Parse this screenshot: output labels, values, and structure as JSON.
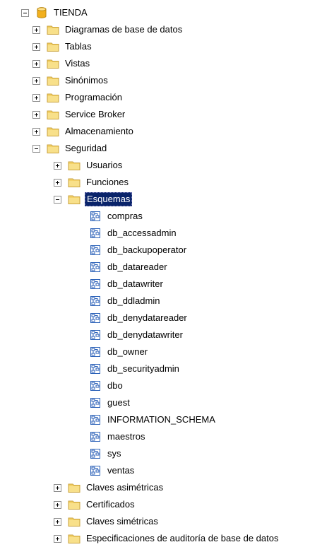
{
  "tree": {
    "root": {
      "label": "TIENDA",
      "icon": "database-icon",
      "expanded": true
    },
    "items": [
      {
        "label": "Diagramas de base de datos",
        "icon": "folder-icon",
        "expander": "plus"
      },
      {
        "label": "Tablas",
        "icon": "folder-icon",
        "expander": "plus"
      },
      {
        "label": "Vistas",
        "icon": "folder-icon",
        "expander": "plus"
      },
      {
        "label": "Sinónimos",
        "icon": "folder-icon",
        "expander": "plus"
      },
      {
        "label": "Programación",
        "icon": "folder-icon",
        "expander": "plus"
      },
      {
        "label": "Service Broker",
        "icon": "folder-icon",
        "expander": "plus"
      },
      {
        "label": "Almacenamiento",
        "icon": "folder-icon",
        "expander": "plus"
      },
      {
        "label": "Seguridad",
        "icon": "folder-icon",
        "expander": "minus"
      }
    ],
    "seguridad": [
      {
        "label": "Usuarios",
        "icon": "folder-icon",
        "expander": "plus"
      },
      {
        "label": "Funciones",
        "icon": "folder-icon",
        "expander": "plus"
      },
      {
        "label": "Esquemas",
        "icon": "folder-icon",
        "expander": "minus",
        "selected": true
      }
    ],
    "esquemas": [
      "compras",
      "db_accessadmin",
      "db_backupoperator",
      "db_datareader",
      "db_datawriter",
      "db_ddladmin",
      "db_denydatareader",
      "db_denydatawriter",
      "db_owner",
      "db_securityadmin",
      "dbo",
      "guest",
      "INFORMATION_SCHEMA",
      "maestros",
      "sys",
      "ventas"
    ],
    "schema_icon": "schema-icon",
    "seguridad_tail": [
      {
        "label": "Claves asimétricas",
        "icon": "folder-icon",
        "expander": "plus"
      },
      {
        "label": "Certificados",
        "icon": "folder-icon",
        "expander": "plus"
      },
      {
        "label": "Claves simétricas",
        "icon": "folder-icon",
        "expander": "plus"
      },
      {
        "label": "Especificaciones de auditoría de base de datos",
        "icon": "folder-icon",
        "expander": "plus"
      }
    ]
  },
  "colors": {
    "selection_bg": "#0a246a",
    "selection_fg": "#ffffff",
    "folder": "#f4d269",
    "database": "#f2b01e",
    "schema": "#2c62b8"
  }
}
